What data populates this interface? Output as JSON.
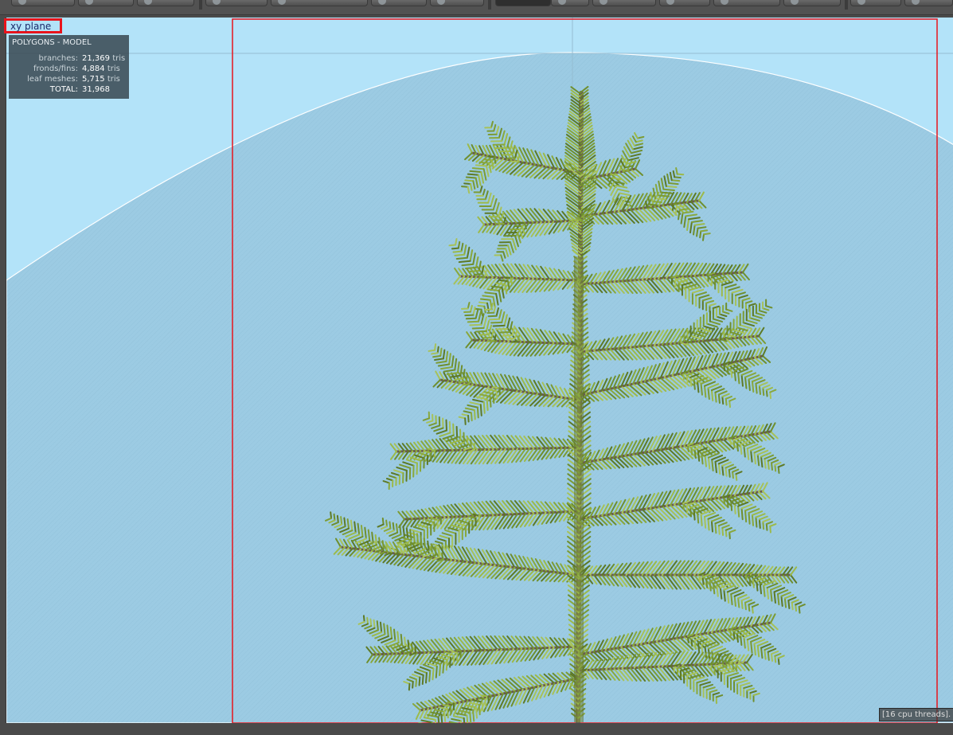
{
  "viewport": {
    "view_label": "xy plane",
    "threads_status": "[16 cpu threads]."
  },
  "stats": {
    "title": "POLYGONS - MODEL",
    "rows": [
      {
        "label": "branches:",
        "value": "21,369",
        "unit": "tris"
      },
      {
        "label": "fronds/fins:",
        "value": "4,884",
        "unit": "tris"
      },
      {
        "label": "leaf meshes:",
        "value": "5,715",
        "unit": "tris"
      },
      {
        "label": "TOTAL:",
        "value": "31,968",
        "unit": ""
      }
    ]
  },
  "colors": {
    "sky": "#b3e3f9",
    "ground_disc": "#9ccbe3",
    "frame_red": "#e8141c",
    "foliage": "#7a9a38",
    "branch": "#6a5a52"
  },
  "icons": {
    "toolbar": [
      "globe-icon",
      "camera-icon",
      "leaf-icon",
      "branch-icon",
      "camera-icon",
      "branch-icon",
      "leaf-icon",
      "render-mode-icon",
      "leaf-icon",
      "chart-icon",
      "globe-icon",
      "camera-icon",
      "leaf-icon",
      "search-icon"
    ]
  }
}
